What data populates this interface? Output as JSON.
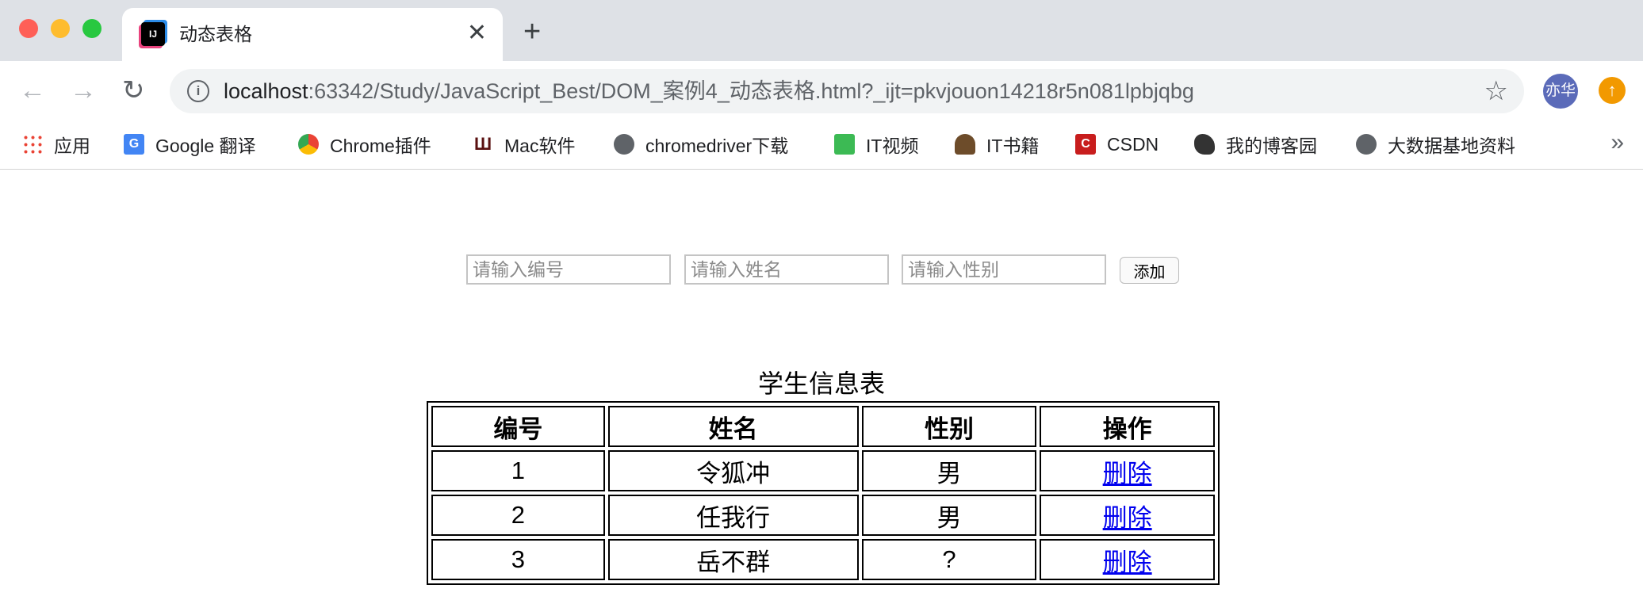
{
  "browser": {
    "tab_title": "动态表格",
    "tab_favicon": "IJ",
    "url_host": "localhost",
    "url_rest": ":63342/Study/JavaScript_Best/DOM_案例4_动态表格.html?_ijt=pkvjouon14218r5n081lpbjqbg",
    "profile_label": "亦华",
    "bookmarks": [
      {
        "label": "应用",
        "icon": "apps-grid-icon"
      },
      {
        "label": "Google 翻译",
        "icon": "google-translate-icon"
      },
      {
        "label": "Chrome插件",
        "icon": "chrome-icon"
      },
      {
        "label": "Mac软件",
        "icon": "mac-software-icon"
      },
      {
        "label": "chromedriver下载",
        "icon": "globe-icon"
      },
      {
        "label": "IT视频",
        "icon": "video-icon"
      },
      {
        "label": "IT书籍",
        "icon": "book-icon"
      },
      {
        "label": "CSDN",
        "icon": "csdn-icon"
      },
      {
        "label": "我的博客园",
        "icon": "blog-icon"
      },
      {
        "label": "大数据基地资料",
        "icon": "globe-icon"
      }
    ]
  },
  "form": {
    "id_placeholder": "请输入编号",
    "name_placeholder": "请输入姓名",
    "gender_placeholder": "请输入性别",
    "add_label": "添加"
  },
  "table": {
    "caption": "学生信息表",
    "headers": [
      "编号",
      "姓名",
      "性别",
      "操作"
    ],
    "rows": [
      {
        "id": "1",
        "name": "令狐冲",
        "gender": "男",
        "action": "删除"
      },
      {
        "id": "2",
        "name": "任我行",
        "gender": "男",
        "action": "删除"
      },
      {
        "id": "3",
        "name": "岳不群",
        "gender": "?",
        "action": "删除"
      }
    ]
  }
}
